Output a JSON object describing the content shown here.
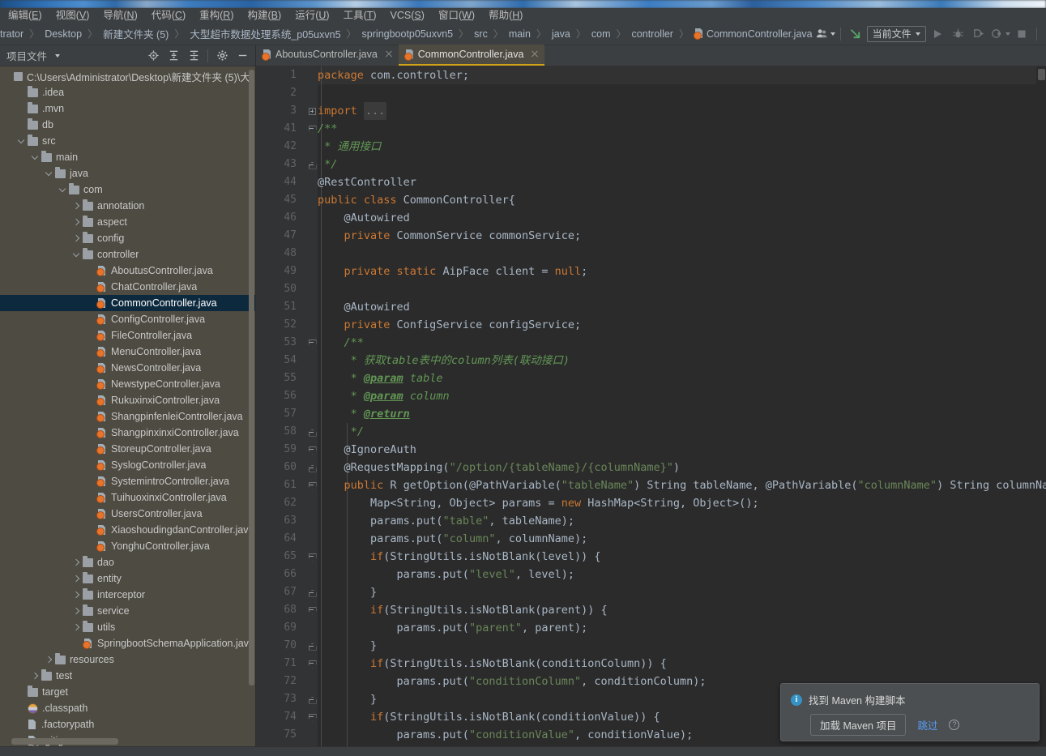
{
  "menubar": {
    "items": [
      {
        "label": "编辑(E)",
        "mnemonic": "E"
      },
      {
        "label": "视图(V)",
        "mnemonic": "V"
      },
      {
        "label": "导航(N)",
        "mnemonic": "N"
      },
      {
        "label": "代码(C)",
        "mnemonic": "C"
      },
      {
        "label": "重构(R)",
        "mnemonic": "R"
      },
      {
        "label": "构建(B)",
        "mnemonic": "B"
      },
      {
        "label": "运行(U)",
        "mnemonic": "U"
      },
      {
        "label": "工具(T)",
        "mnemonic": "T"
      },
      {
        "label": "VCS(S)",
        "mnemonic": "S"
      },
      {
        "label": "窗口(W)",
        "mnemonic": "W"
      },
      {
        "label": "帮助(H)",
        "mnemonic": "H"
      }
    ]
  },
  "navbar": {
    "crumbs": [
      "trator",
      "Desktop",
      "新建文件夹 (5)",
      "大型超市数据处理系统_p05uxvn5",
      "springbootp05uxvn5",
      "src",
      "main",
      "java",
      "com",
      "controller"
    ],
    "current_file": "CommonController.java",
    "run_config": "当前文件",
    "icons": {
      "profile": "user-profile-icon",
      "update": "update-project-icon",
      "run": "run-icon",
      "debug": "debug-icon",
      "run_with_coverage": "run-with-coverage-icon",
      "profiler": "profiler-icon",
      "stop": "stop-icon",
      "search": "search-everywhere-icon",
      "settings": "settings-icon"
    }
  },
  "project_panel": {
    "title": "项目文件",
    "toolbar_icons": [
      "locate-icon",
      "expand-all-icon",
      "collapse-all-icon",
      "gear-icon",
      "hide-icon"
    ],
    "tree": [
      {
        "label": "C:\\Users\\Administrator\\Desktop\\新建文件夹 (5)\\大型超",
        "depth": 0,
        "icon": "module",
        "arrow": "none",
        "selected": false
      },
      {
        "label": ".idea",
        "depth": 1,
        "icon": "folder",
        "arrow": "none",
        "selected": false
      },
      {
        "label": ".mvn",
        "depth": 1,
        "icon": "folder",
        "arrow": "none",
        "selected": false
      },
      {
        "label": "db",
        "depth": 1,
        "icon": "folder",
        "arrow": "none",
        "selected": false
      },
      {
        "label": "src",
        "depth": 1,
        "icon": "folder",
        "arrow": "down-thin",
        "selected": false
      },
      {
        "label": "main",
        "depth": 2,
        "icon": "folder",
        "arrow": "down",
        "selected": false
      },
      {
        "label": "java",
        "depth": 3,
        "icon": "folder",
        "arrow": "down",
        "selected": false
      },
      {
        "label": "com",
        "depth": 4,
        "icon": "folder",
        "arrow": "down",
        "selected": false
      },
      {
        "label": "annotation",
        "depth": 5,
        "icon": "folder",
        "arrow": "right",
        "selected": false
      },
      {
        "label": "aspect",
        "depth": 5,
        "icon": "folder",
        "arrow": "right",
        "selected": false
      },
      {
        "label": "config",
        "depth": 5,
        "icon": "folder",
        "arrow": "right",
        "selected": false
      },
      {
        "label": "controller",
        "depth": 5,
        "icon": "folder",
        "arrow": "down",
        "selected": false
      },
      {
        "label": "AboutusController.java",
        "depth": 6,
        "icon": "java",
        "arrow": "none",
        "selected": false
      },
      {
        "label": "ChatController.java",
        "depth": 6,
        "icon": "java",
        "arrow": "none",
        "selected": false
      },
      {
        "label": "CommonController.java",
        "depth": 6,
        "icon": "java",
        "arrow": "none",
        "selected": true
      },
      {
        "label": "ConfigController.java",
        "depth": 6,
        "icon": "java",
        "arrow": "none",
        "selected": false
      },
      {
        "label": "FileController.java",
        "depth": 6,
        "icon": "java",
        "arrow": "none",
        "selected": false
      },
      {
        "label": "MenuController.java",
        "depth": 6,
        "icon": "java",
        "arrow": "none",
        "selected": false
      },
      {
        "label": "NewsController.java",
        "depth": 6,
        "icon": "java",
        "arrow": "none",
        "selected": false
      },
      {
        "label": "NewstypeController.java",
        "depth": 6,
        "icon": "java",
        "arrow": "none",
        "selected": false
      },
      {
        "label": "RukuxinxiController.java",
        "depth": 6,
        "icon": "java",
        "arrow": "none",
        "selected": false
      },
      {
        "label": "ShangpinfenleiController.java",
        "depth": 6,
        "icon": "java",
        "arrow": "none",
        "selected": false
      },
      {
        "label": "ShangpinxinxiController.java",
        "depth": 6,
        "icon": "java",
        "arrow": "none",
        "selected": false
      },
      {
        "label": "StoreupController.java",
        "depth": 6,
        "icon": "java",
        "arrow": "none",
        "selected": false
      },
      {
        "label": "SyslogController.java",
        "depth": 6,
        "icon": "java",
        "arrow": "none",
        "selected": false
      },
      {
        "label": "SystemintroController.java",
        "depth": 6,
        "icon": "java",
        "arrow": "none",
        "selected": false
      },
      {
        "label": "TuihuoxinxiController.java",
        "depth": 6,
        "icon": "java",
        "arrow": "none",
        "selected": false
      },
      {
        "label": "UsersController.java",
        "depth": 6,
        "icon": "java",
        "arrow": "none",
        "selected": false
      },
      {
        "label": "XiaoshoudingdanController.java",
        "depth": 6,
        "icon": "java",
        "arrow": "none",
        "selected": false
      },
      {
        "label": "YonghuController.java",
        "depth": 6,
        "icon": "java",
        "arrow": "none",
        "selected": false
      },
      {
        "label": "dao",
        "depth": 5,
        "icon": "folder",
        "arrow": "right",
        "selected": false
      },
      {
        "label": "entity",
        "depth": 5,
        "icon": "folder",
        "arrow": "right",
        "selected": false
      },
      {
        "label": "interceptor",
        "depth": 5,
        "icon": "folder",
        "arrow": "right",
        "selected": false
      },
      {
        "label": "service",
        "depth": 5,
        "icon": "folder",
        "arrow": "right",
        "selected": false
      },
      {
        "label": "utils",
        "depth": 5,
        "icon": "folder",
        "arrow": "right",
        "selected": false
      },
      {
        "label": "SpringbootSchemaApplication.java",
        "depth": 5,
        "icon": "java",
        "arrow": "none",
        "selected": false
      },
      {
        "label": "resources",
        "depth": 3,
        "icon": "folder",
        "arrow": "right",
        "selected": false
      },
      {
        "label": "test",
        "depth": 2,
        "icon": "folder",
        "arrow": "right",
        "selected": false
      },
      {
        "label": "target",
        "depth": 1,
        "icon": "folder",
        "arrow": "none",
        "selected": false
      },
      {
        "label": ".classpath",
        "depth": 1,
        "icon": "classpath",
        "arrow": "none",
        "selected": false
      },
      {
        "label": ".factorypath",
        "depth": 1,
        "icon": "doc",
        "arrow": "none",
        "selected": false
      },
      {
        "label": ".gitignore",
        "depth": 1,
        "icon": "git",
        "arrow": "none",
        "selected": false
      }
    ]
  },
  "editor": {
    "tabs": [
      {
        "label": "AboutusController.java",
        "active": false
      },
      {
        "label": "CommonController.java",
        "active": true
      }
    ],
    "lines": [
      {
        "num": "1",
        "fold": "none",
        "indent": 0,
        "tokens": [
          {
            "t": "package ",
            "c": "kw"
          },
          {
            "t": "com.controller;",
            "c": "plain"
          }
        ]
      },
      {
        "num": "2",
        "fold": "none",
        "indent": 0,
        "tokens": []
      },
      {
        "num": "3",
        "fold": "plus",
        "indent": 0,
        "tokens": [
          {
            "t": "import ",
            "c": "kw"
          },
          {
            "t": "...",
            "c": "fold"
          }
        ]
      },
      {
        "num": "41",
        "fold": "tri-dn",
        "indent": 0,
        "tokens": [
          {
            "t": "/**",
            "c": "cmt"
          }
        ]
      },
      {
        "num": "42",
        "fold": "none",
        "indent": 0,
        "tokens": [
          {
            "t": " * 通用接口",
            "c": "cmt"
          }
        ]
      },
      {
        "num": "43",
        "fold": "end",
        "indent": 0,
        "tokens": [
          {
            "t": " */",
            "c": "cmt"
          }
        ]
      },
      {
        "num": "44",
        "fold": "none",
        "indent": 0,
        "tokens": [
          {
            "t": "@RestController",
            "c": "anng"
          }
        ]
      },
      {
        "num": "45",
        "fold": "none",
        "indent": 0,
        "tokens": [
          {
            "t": "public class ",
            "c": "kw"
          },
          {
            "t": "CommonController{",
            "c": "plain"
          }
        ]
      },
      {
        "num": "46",
        "fold": "none",
        "indent": 1,
        "tokens": [
          {
            "t": "    @Autowired",
            "c": "anng"
          }
        ]
      },
      {
        "num": "47",
        "fold": "none",
        "indent": 1,
        "tokens": [
          {
            "t": "    private ",
            "c": "kw"
          },
          {
            "t": "CommonService commonService;",
            "c": "plain"
          }
        ]
      },
      {
        "num": "48",
        "fold": "none",
        "indent": 0,
        "tokens": []
      },
      {
        "num": "49",
        "fold": "none",
        "indent": 1,
        "tokens": [
          {
            "t": "    private static ",
            "c": "kw"
          },
          {
            "t": "AipFace client = ",
            "c": "plain"
          },
          {
            "t": "null",
            "c": "kw"
          },
          {
            "t": ";",
            "c": "plain"
          }
        ]
      },
      {
        "num": "50",
        "fold": "none",
        "indent": 0,
        "tokens": []
      },
      {
        "num": "51",
        "fold": "none",
        "indent": 1,
        "tokens": [
          {
            "t": "    @Autowired",
            "c": "anng"
          }
        ]
      },
      {
        "num": "52",
        "fold": "none",
        "indent": 1,
        "tokens": [
          {
            "t": "    private ",
            "c": "kw"
          },
          {
            "t": "ConfigService configService;",
            "c": "plain"
          }
        ]
      },
      {
        "num": "53",
        "fold": "tri-dn",
        "indent": 1,
        "tokens": [
          {
            "t": "    /**",
            "c": "cmt"
          }
        ]
      },
      {
        "num": "54",
        "fold": "none",
        "indent": 1,
        "tokens": [
          {
            "t": "     * 获取table表中的column列表(联动接口)",
            "c": "cmt"
          }
        ]
      },
      {
        "num": "55",
        "fold": "none",
        "indent": 1,
        "tokens": [
          {
            "t": "     * ",
            "c": "cmt"
          },
          {
            "t": "@param",
            "c": "cmt-tag"
          },
          {
            "t": " table",
            "c": "cmt"
          }
        ]
      },
      {
        "num": "56",
        "fold": "none",
        "indent": 1,
        "tokens": [
          {
            "t": "     * ",
            "c": "cmt"
          },
          {
            "t": "@param",
            "c": "cmt-tag"
          },
          {
            "t": " column",
            "c": "cmt"
          }
        ]
      },
      {
        "num": "57",
        "fold": "none",
        "indent": 1,
        "tokens": [
          {
            "t": "     * ",
            "c": "cmt"
          },
          {
            "t": "@return",
            "c": "cmt-tag"
          }
        ]
      },
      {
        "num": "58",
        "fold": "end",
        "indent": 1,
        "tokens": [
          {
            "t": "     */",
            "c": "cmt"
          }
        ]
      },
      {
        "num": "59",
        "fold": "tri-dn",
        "indent": 1,
        "tokens": [
          {
            "t": "    @IgnoreAuth",
            "c": "anng"
          }
        ]
      },
      {
        "num": "60",
        "fold": "end",
        "indent": 1,
        "tokens": [
          {
            "t": "    @RequestMapping(",
            "c": "anng"
          },
          {
            "t": "\"/option/{tableName}/{columnName}\"",
            "c": "str"
          },
          {
            "t": ")",
            "c": "anng"
          }
        ]
      },
      {
        "num": "61",
        "fold": "tri-dn",
        "indent": 1,
        "tokens": [
          {
            "t": "    public ",
            "c": "kw"
          },
          {
            "t": "R getOption(",
            "c": "plain"
          },
          {
            "t": "@PathVariable(",
            "c": "anng"
          },
          {
            "t": "\"tableName\"",
            "c": "str"
          },
          {
            "t": ")",
            "c": "anng"
          },
          {
            "t": " String tableName, ",
            "c": "plain"
          },
          {
            "t": "@PathVariable(",
            "c": "anng"
          },
          {
            "t": "\"columnName\"",
            "c": "str"
          },
          {
            "t": ")",
            "c": "anng"
          },
          {
            "t": " String columnName",
            "c": "plain"
          }
        ]
      },
      {
        "num": "62",
        "fold": "none",
        "indent": 2,
        "tokens": [
          {
            "t": "        Map<String, Object> params = ",
            "c": "plain"
          },
          {
            "t": "new ",
            "c": "kw"
          },
          {
            "t": "HashMap<String, Object>();",
            "c": "plain"
          }
        ]
      },
      {
        "num": "63",
        "fold": "none",
        "indent": 2,
        "tokens": [
          {
            "t": "        params.put(",
            "c": "plain"
          },
          {
            "t": "\"table\"",
            "c": "str"
          },
          {
            "t": ", tableName);",
            "c": "plain"
          }
        ]
      },
      {
        "num": "64",
        "fold": "none",
        "indent": 2,
        "tokens": [
          {
            "t": "        params.put(",
            "c": "plain"
          },
          {
            "t": "\"column\"",
            "c": "str"
          },
          {
            "t": ", columnName);",
            "c": "plain"
          }
        ]
      },
      {
        "num": "65",
        "fold": "tri-dn",
        "indent": 2,
        "tokens": [
          {
            "t": "        ",
            "c": "plain"
          },
          {
            "t": "if",
            "c": "kw"
          },
          {
            "t": "(StringUtils.isNotBlank(level)) {",
            "c": "plain"
          }
        ]
      },
      {
        "num": "66",
        "fold": "none",
        "indent": 3,
        "tokens": [
          {
            "t": "            params.put(",
            "c": "plain"
          },
          {
            "t": "\"level\"",
            "c": "str"
          },
          {
            "t": ", level);",
            "c": "plain"
          }
        ]
      },
      {
        "num": "67",
        "fold": "end",
        "indent": 2,
        "tokens": [
          {
            "t": "        }",
            "c": "plain"
          }
        ]
      },
      {
        "num": "68",
        "fold": "tri-dn",
        "indent": 2,
        "tokens": [
          {
            "t": "        ",
            "c": "plain"
          },
          {
            "t": "if",
            "c": "kw"
          },
          {
            "t": "(StringUtils.isNotBlank(parent)) {",
            "c": "plain"
          }
        ]
      },
      {
        "num": "69",
        "fold": "none",
        "indent": 3,
        "tokens": [
          {
            "t": "            params.put(",
            "c": "plain"
          },
          {
            "t": "\"parent\"",
            "c": "str"
          },
          {
            "t": ", parent);",
            "c": "plain"
          }
        ]
      },
      {
        "num": "70",
        "fold": "end",
        "indent": 2,
        "tokens": [
          {
            "t": "        }",
            "c": "plain"
          }
        ]
      },
      {
        "num": "71",
        "fold": "tri-dn",
        "indent": 2,
        "tokens": [
          {
            "t": "        ",
            "c": "plain"
          },
          {
            "t": "if",
            "c": "kw"
          },
          {
            "t": "(StringUtils.isNotBlank(conditionColumn)) {",
            "c": "plain"
          }
        ]
      },
      {
        "num": "72",
        "fold": "none",
        "indent": 3,
        "tokens": [
          {
            "t": "            params.put(",
            "c": "plain"
          },
          {
            "t": "\"conditionColumn\"",
            "c": "str"
          },
          {
            "t": ", conditionColumn);",
            "c": "plain"
          }
        ]
      },
      {
        "num": "73",
        "fold": "end",
        "indent": 2,
        "tokens": [
          {
            "t": "        }",
            "c": "plain"
          }
        ]
      },
      {
        "num": "74",
        "fold": "tri-dn",
        "indent": 2,
        "tokens": [
          {
            "t": "        ",
            "c": "plain"
          },
          {
            "t": "if",
            "c": "kw"
          },
          {
            "t": "(StringUtils.isNotBlank(conditionValue)) {",
            "c": "plain"
          }
        ]
      },
      {
        "num": "75",
        "fold": "none",
        "indent": 3,
        "tokens": [
          {
            "t": "            params.put(",
            "c": "plain"
          },
          {
            "t": "\"conditionValue\"",
            "c": "str"
          },
          {
            "t": ", conditionValue);",
            "c": "plain"
          }
        ]
      }
    ]
  },
  "notification": {
    "title": "找到 Maven 构建脚本",
    "primary_action": "加载 Maven 项目",
    "link_action": "跳过",
    "help_icon": "help-icon",
    "info_icon": "info-icon"
  },
  "colors": {
    "accent_tab": "#d1a11a",
    "selection": "#0d293e",
    "panel_bg": "#4e4b42",
    "editor_bg": "#2b2b2b",
    "chrome_bg": "#3c3f41",
    "link": "#589df6",
    "info": "#3592c4",
    "keyword": "#cc7832",
    "string": "#6a8759",
    "comment": "#629755",
    "annotation": "#bbb529",
    "java_icon": "#e8742c"
  }
}
